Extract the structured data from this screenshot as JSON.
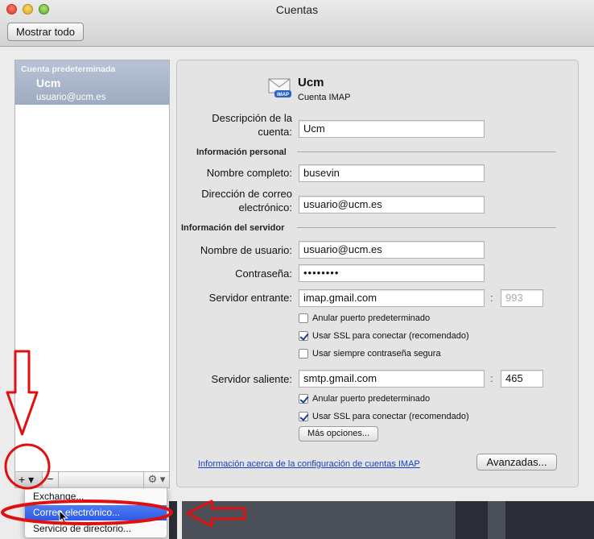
{
  "window": {
    "title": "Cuentas",
    "show_all_label": "Mostrar todo"
  },
  "sidebar": {
    "section_header": "Cuenta predeterminada",
    "account": {
      "name": "Ucm",
      "email": "usuario@ucm.es"
    },
    "add_label": "+ ▾",
    "remove_label": "−",
    "gear_label": "⚙ ▾"
  },
  "account_header": {
    "name": "Ucm",
    "type": "Cuenta IMAP",
    "icon": "mail-envelope-icon"
  },
  "form": {
    "description_label": "Descripción de la cuenta:",
    "description_value": "Ucm",
    "personal_section": "Información personal",
    "full_name_label": "Nombre completo:",
    "full_name_value": "busevin",
    "email_label": "Dirección de correo electrónico:",
    "email_value": "usuario@ucm.es",
    "server_section": "Información del servidor",
    "username_label": "Nombre de usuario:",
    "username_value": "usuario@ucm.es",
    "password_label": "Contraseña:",
    "password_value": "••••••••",
    "incoming_label": "Servidor entrante:",
    "incoming_value": "imap.gmail.com",
    "incoming_port": "993",
    "incoming_options": [
      {
        "label": "Anular puerto predeterminado",
        "checked": false
      },
      {
        "label": "Usar SSL para conectar (recomendado)",
        "checked": true
      },
      {
        "label": "Usar siempre contraseña segura",
        "checked": false
      }
    ],
    "outgoing_label": "Servidor saliente:",
    "outgoing_value": "smtp.gmail.com",
    "outgoing_port": "465",
    "outgoing_options": [
      {
        "label": "Anular puerto predeterminado",
        "checked": true
      },
      {
        "label": "Usar SSL para conectar (recomendado)",
        "checked": true
      }
    ],
    "more_options_label": "Más opciones...",
    "info_link": "Información acerca de la configuración de cuentas IMAP",
    "advanced_label": "Avanzadas..."
  },
  "popup_menu": {
    "items": [
      {
        "label": "Exchange..."
      },
      {
        "label": "Correo electrónico...",
        "selected": true
      },
      {
        "label": "Servicio de directorio..."
      }
    ]
  },
  "colors": {
    "annotation": "#e01010",
    "menu_highlight": "#2d5ae6",
    "selection": "#a4b1c6"
  }
}
